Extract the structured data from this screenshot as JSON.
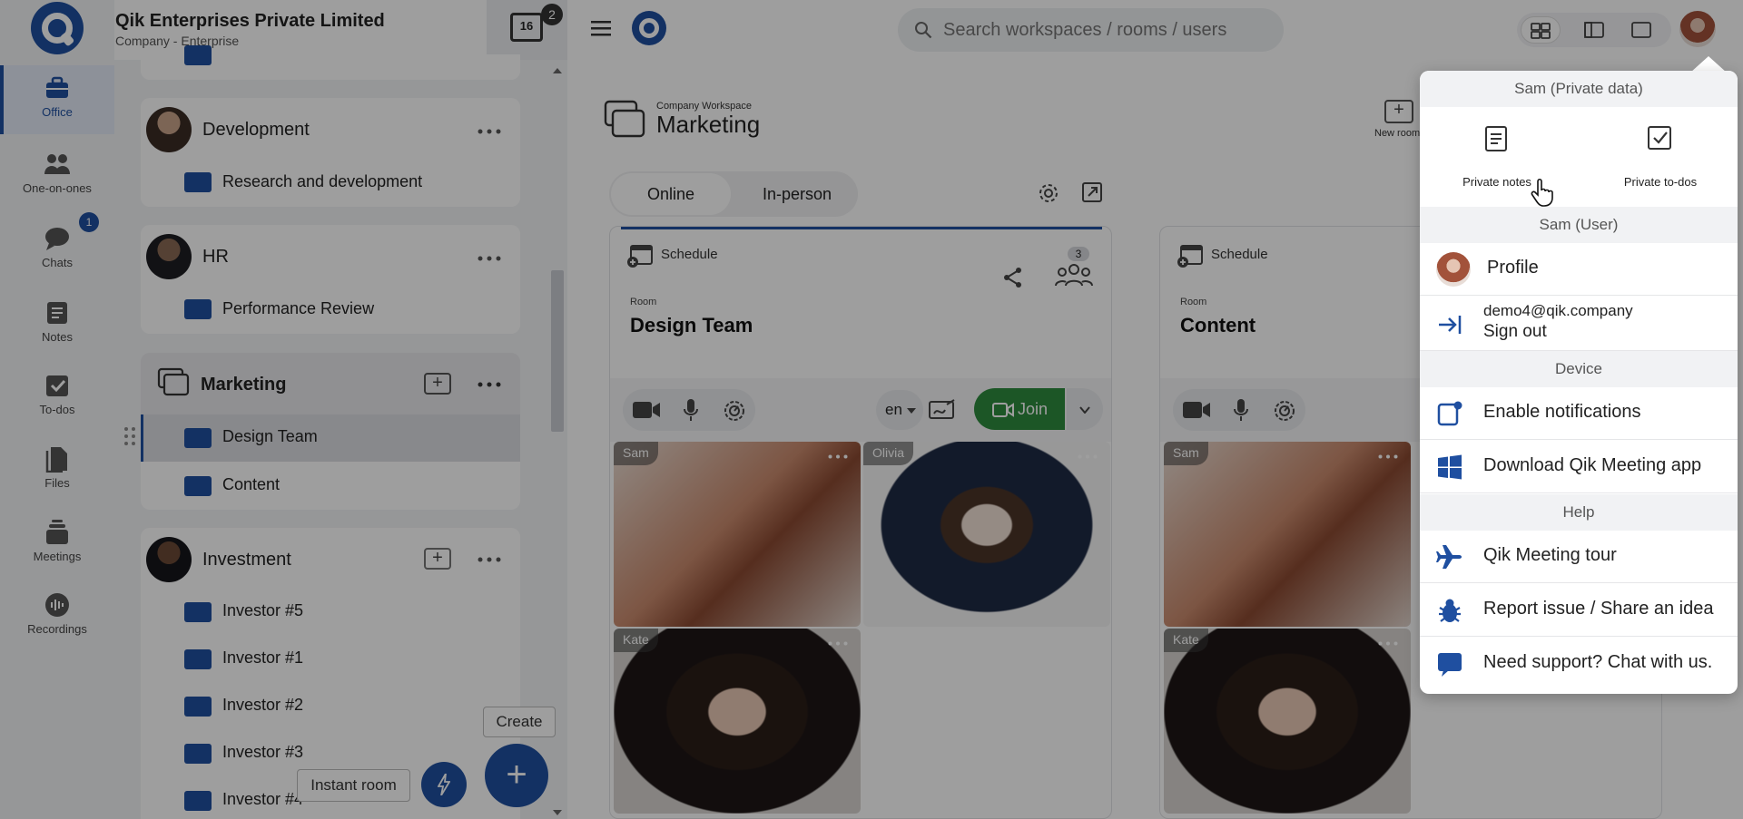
{
  "company": {
    "name": "Qik Enterprises Private Limited",
    "plan": "Company - Enterprise",
    "calendar_day": "16",
    "calendar_badge": "2"
  },
  "rail": [
    {
      "label": "Office",
      "icon": "briefcase-icon"
    },
    {
      "label": "One-on-ones",
      "icon": "people-icon"
    },
    {
      "label": "Chats",
      "icon": "chat-icon",
      "badge": "1"
    },
    {
      "label": "Notes",
      "icon": "notes-icon"
    },
    {
      "label": "To-dos",
      "icon": "todo-icon"
    },
    {
      "label": "Files",
      "icon": "files-icon"
    },
    {
      "label": "Meetings",
      "icon": "meetings-icon"
    },
    {
      "label": "Recordings",
      "icon": "recordings-icon"
    }
  ],
  "sidebar": {
    "groups": [
      {
        "name": "Development",
        "rooms": [
          "Research and development"
        ]
      },
      {
        "name": "HR",
        "rooms": [
          "Performance Review"
        ]
      },
      {
        "name": "Marketing",
        "rooms": [
          "Design Team",
          "Content"
        ]
      },
      {
        "name": "Investment",
        "rooms": [
          "Investor #5",
          "Investor #1",
          "Investor #2",
          "Investor #3",
          "Investor #4"
        ]
      }
    ]
  },
  "actions": {
    "create": "Create",
    "instant_room": "Instant room"
  },
  "search": {
    "placeholder": "Search workspaces / rooms / users"
  },
  "workspace": {
    "kicker": "Company Workspace",
    "title": "Marketing",
    "new_room": "New room",
    "tabs": [
      "Online",
      "In-person"
    ]
  },
  "rooms": [
    {
      "schedule": "Schedule",
      "kicker": "Room",
      "title": "Design Team",
      "participants": "3",
      "lang": "en",
      "join": "Join",
      "tiles": [
        "Sam",
        "Olivia",
        "Kate"
      ]
    },
    {
      "schedule": "Schedule",
      "kicker": "Room",
      "title": "Content",
      "tiles": [
        "Sam",
        "Kate"
      ]
    }
  ],
  "menu": {
    "private_header": "Sam (Private data)",
    "private_notes": "Private notes",
    "private_todos": "Private to-dos",
    "user_header": "Sam (User)",
    "profile": "Profile",
    "email": "demo4@qik.company",
    "sign_out": "Sign out",
    "device_header": "Device",
    "enable_notifications": "Enable notifications",
    "download_app": "Download Qik Meeting app",
    "help_header": "Help",
    "tour": "Qik Meeting tour",
    "report": "Report issue / Share an idea",
    "support": "Need support? Chat with us."
  },
  "colors": {
    "brand": "#1f4fa0",
    "join": "#2e8b3e"
  }
}
